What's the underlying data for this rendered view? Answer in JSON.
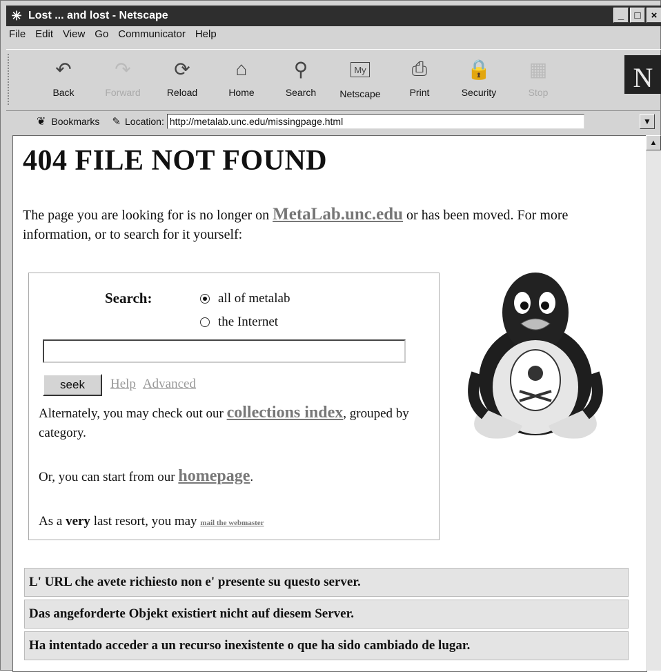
{
  "window": {
    "title": "Lost ... and lost - Netscape",
    "app_icon": "netscape-star-icon",
    "buttons": [
      "_",
      "□",
      "×"
    ]
  },
  "menu": [
    "File",
    "Edit",
    "View",
    "Go",
    "Communicator",
    "Help"
  ],
  "toolbar": {
    "buttons": [
      {
        "label": "Back",
        "icon": "back-arrow-icon",
        "enabled": true
      },
      {
        "label": "Forward",
        "icon": "forward-arrow-icon",
        "enabled": false
      },
      {
        "label": "Reload",
        "icon": "reload-icon",
        "enabled": true
      },
      {
        "label": "Home",
        "icon": "home-icon",
        "enabled": true
      },
      {
        "label": "Search",
        "icon": "search-icon",
        "enabled": true
      },
      {
        "label": "Netscape",
        "icon": "my-netscape-icon",
        "enabled": true
      },
      {
        "label": "Print",
        "icon": "print-icon",
        "enabled": true
      },
      {
        "label": "Security",
        "icon": "lock-icon",
        "enabled": true
      },
      {
        "label": "Stop",
        "icon": "stop-icon",
        "enabled": false
      }
    ],
    "logo": "N"
  },
  "location_bar": {
    "bookmarks_label": "Bookmarks",
    "location_label": "Location:",
    "url": "http://metalab.unc.edu/missingpage.html"
  },
  "page": {
    "heading": "404 FILE NOT FOUND",
    "intro_before": "The page you are looking for is no longer on ",
    "intro_link": "MetaLab.unc.edu",
    "intro_after": " or has been moved. For more information, or to search for it yourself:",
    "search": {
      "label": "Search:",
      "options": [
        {
          "label": "all of metalab",
          "selected": true
        },
        {
          "label": "the Internet",
          "selected": false
        }
      ],
      "query": "",
      "button": "seek",
      "help": "Help",
      "advanced": "Advanced"
    },
    "alt_before": "Alternately, you may check out our ",
    "alt_link": "collections index",
    "alt_after": ", grouped by category.",
    "or_before": "Or, you can start from our ",
    "or_link": "homepage",
    "or_after": ".",
    "last_before": "As a ",
    "last_bold": "very",
    "last_after": " last resort, you may ",
    "last_link": "mail the webmaster",
    "messages": [
      "L' URL che avete richiesto non e' presente su questo server.",
      "Das angeforderte Objekt existiert nicht auf diesem Server.",
      "Ha intentado acceder a un recurso inexistente o que ha sido cambiado de lugar."
    ]
  }
}
